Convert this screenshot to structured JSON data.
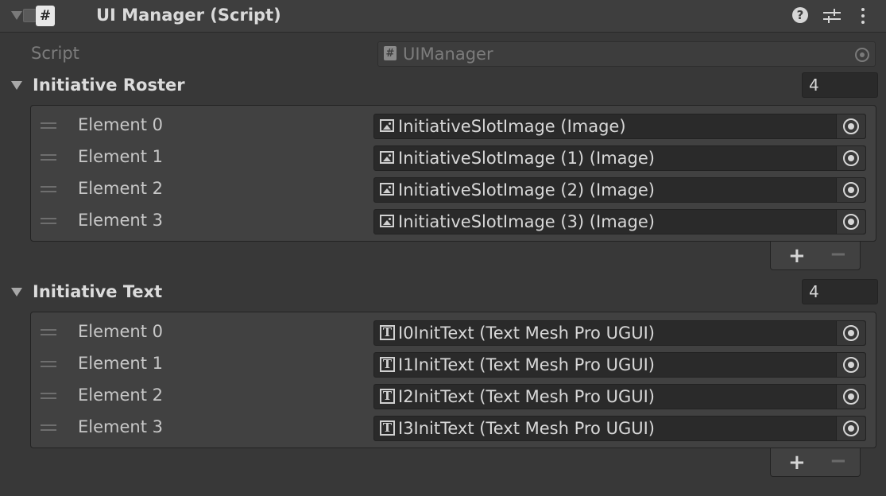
{
  "component": {
    "title": "UI Manager (Script)",
    "icon": "script-hash-icon",
    "icon_glyph": "#",
    "help_glyph": "?"
  },
  "script_field": {
    "label": "Script",
    "value": "UIManager",
    "icon_glyph": "#"
  },
  "initiative_roster": {
    "label": "Initiative Roster",
    "size": "4",
    "elements": [
      {
        "label": "Element 0",
        "value": "InitiativeSlotImage (Image)"
      },
      {
        "label": "Element 1",
        "value": "InitiativeSlotImage (1) (Image)"
      },
      {
        "label": "Element 2",
        "value": "InitiativeSlotImage (2) (Image)"
      },
      {
        "label": "Element 3",
        "value": "InitiativeSlotImage (3) (Image)"
      }
    ],
    "add_label": "+",
    "remove_label": "−"
  },
  "initiative_text": {
    "label": "Initiative Text",
    "size": "4",
    "elements": [
      {
        "label": "Element 0",
        "value": "I0InitText (Text Mesh Pro UGUI)"
      },
      {
        "label": "Element 1",
        "value": "I1InitText (Text Mesh Pro UGUI)"
      },
      {
        "label": "Element 2",
        "value": "I2InitText (Text Mesh Pro UGUI)"
      },
      {
        "label": "Element 3",
        "value": "I3InitText (Text Mesh Pro UGUI)"
      }
    ],
    "add_label": "+",
    "remove_label": "−"
  },
  "colors": {
    "background": "#383838",
    "field_dark": "#2a2a2a",
    "text": "#c8c8c8"
  }
}
